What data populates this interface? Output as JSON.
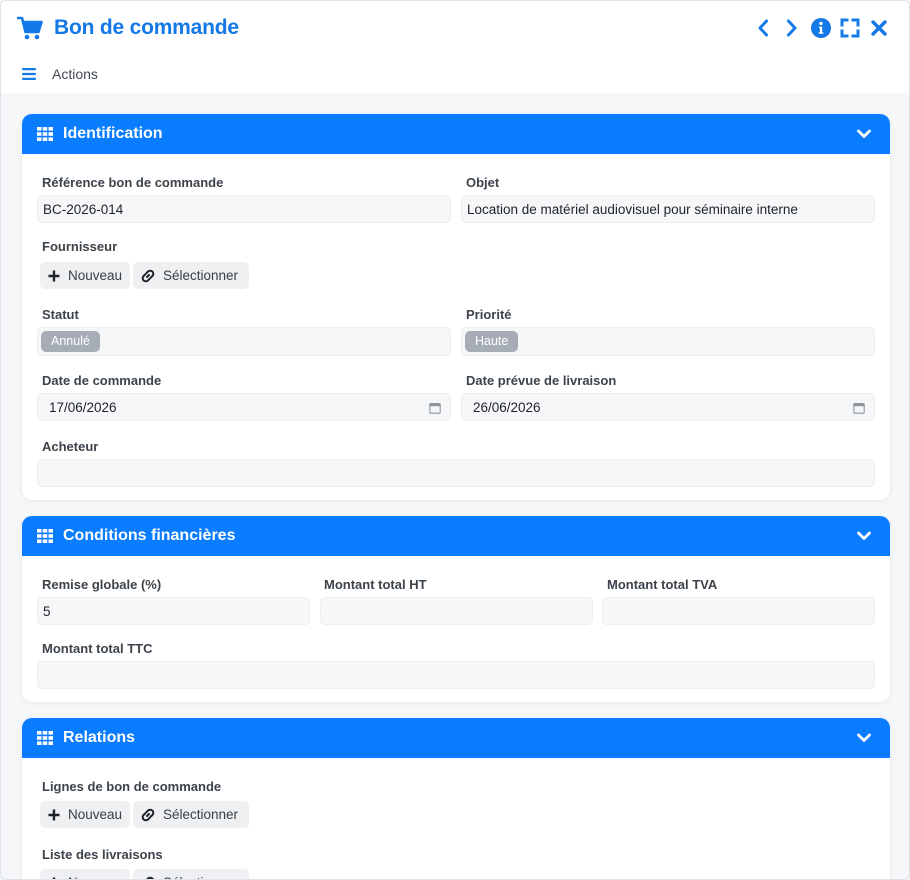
{
  "window": {
    "title": "Bon de commande",
    "actions_label": "Actions"
  },
  "colors": {
    "accent": "#0a7cff",
    "title": "#1478e6",
    "badge": "#a6adb6"
  },
  "sections": {
    "identification": {
      "title": "Identification",
      "reference_label": "Référence bon de commande",
      "reference_value": "BC-2026-014",
      "objet_label": "Objet",
      "objet_value": "Location de matériel audiovisuel pour séminaire interne",
      "fournisseur_label": "Fournisseur",
      "new_label": "Nouveau",
      "select_label": "Sélectionner",
      "statut_label": "Statut",
      "statut_value": "Annulé",
      "priorite_label": "Priorité",
      "priorite_value": "Haute",
      "date_commande_label": "Date de commande",
      "date_commande_value": "17/06/2026",
      "date_livraison_label": "Date prévue de livraison",
      "date_livraison_value": "26/06/2026",
      "acheteur_label": "Acheteur",
      "acheteur_value": ""
    },
    "financial": {
      "title": "Conditions financières",
      "remise_label": "Remise globale (%)",
      "remise_value": "5",
      "ht_label": "Montant total HT",
      "ht_value": "",
      "tva_label": "Montant total TVA",
      "tva_value": "",
      "ttc_label": "Montant total TTC",
      "ttc_value": ""
    },
    "relations": {
      "title": "Relations",
      "lignes_label": "Lignes de bon de commande",
      "livraisons_label": "Liste des livraisons",
      "new_label": "Nouveau",
      "select_label": "Sélectionner"
    }
  }
}
